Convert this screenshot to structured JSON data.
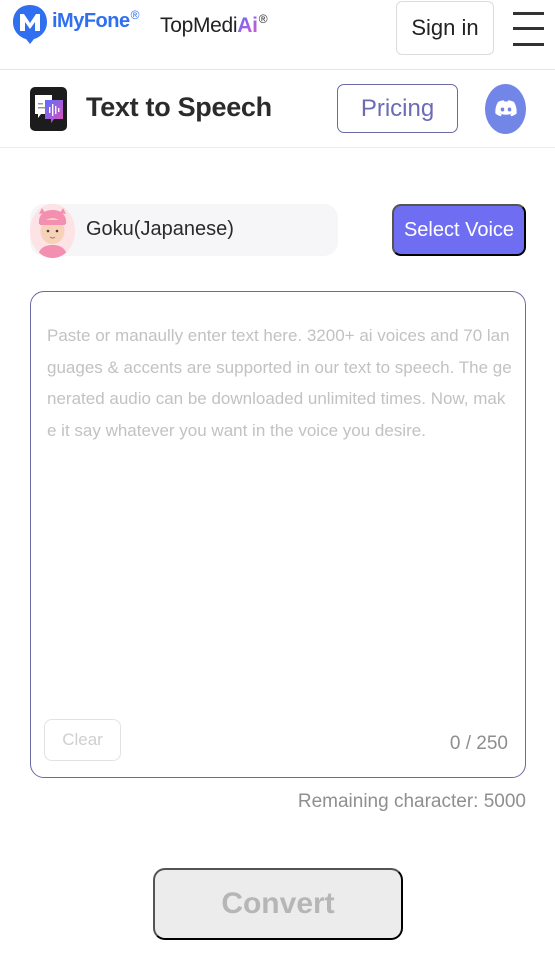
{
  "header": {
    "brand_name": "iMyFone",
    "brand_reg": "®",
    "product_name_prefix": "TopMedi",
    "product_name_suffix": "Ai",
    "product_reg": "®",
    "sign_in_label": "Sign in",
    "menu_icon": "hamburger-menu-icon"
  },
  "subheader": {
    "tool_icon": "text-to-speech-icon",
    "title": "Text to Speech",
    "pricing_label": "Pricing",
    "discord_icon": "discord-icon"
  },
  "voice": {
    "selected_name": "Goku(Japanese)",
    "avatar_icon": "voice-avatar",
    "select_voice_label": "Select Voice"
  },
  "editor": {
    "value": "",
    "placeholder": "Paste or manaully enter text here. 3200+ ai voices and 70 languages & accents are supported in our text to speech. The generated audio can be downloaded unlimited times. Now, make it say whatever you want in the voice you desire.",
    "clear_label": "Clear",
    "char_count": "0 / 250"
  },
  "remaining": {
    "label": "Remaining character: ",
    "value": "5000"
  },
  "convert_label": "Convert",
  "colors": {
    "accent": "#6f6ef2",
    "brand_blue": "#2f6ff0",
    "discord": "#7286e8",
    "border_purple": "#6b6aa3"
  }
}
